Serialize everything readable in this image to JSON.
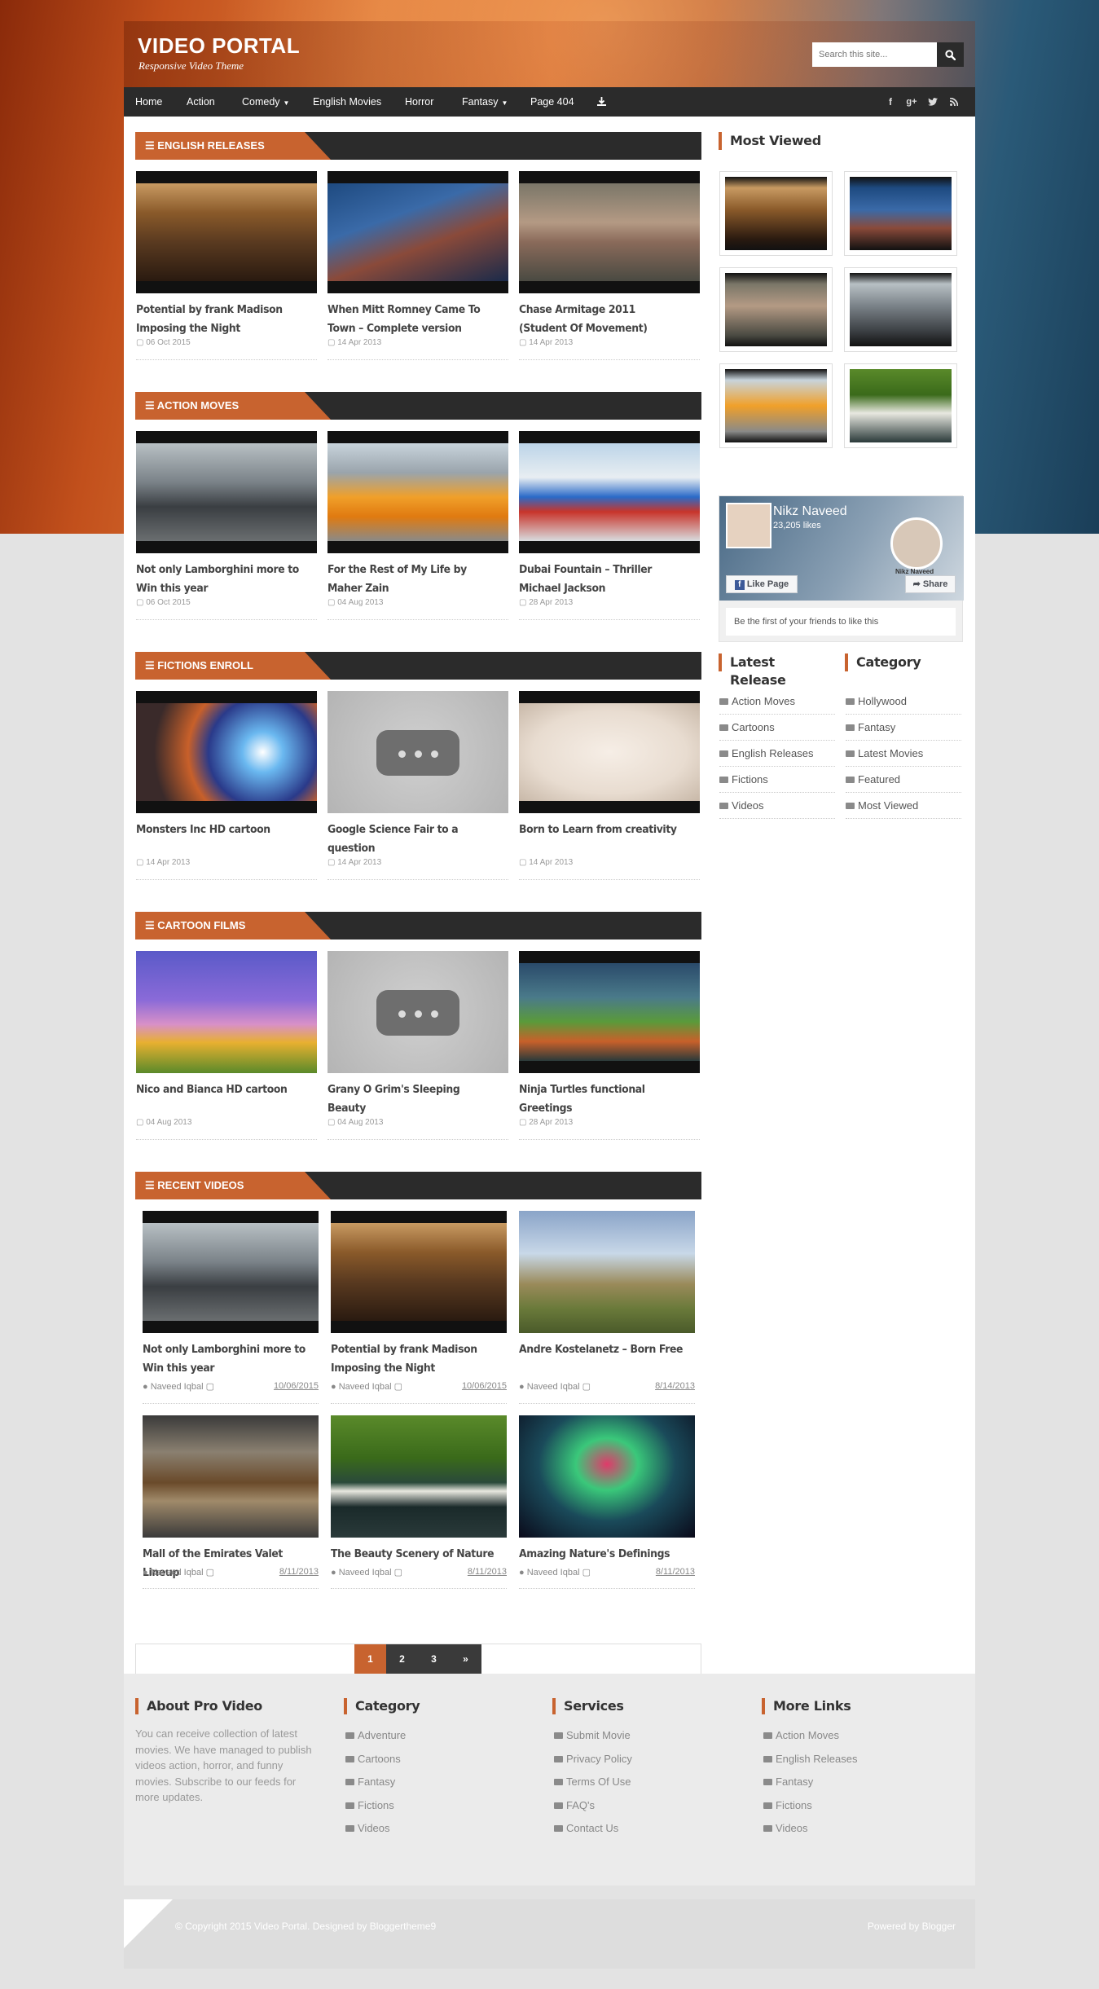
{
  "header": {
    "title": "VIDEO PORTAL",
    "tagline": "Responsive Video Theme",
    "search_placeholder": "Search this site..."
  },
  "nav": {
    "items": [
      "Home",
      "Action",
      "Comedy",
      "English Movies",
      "Horror",
      "Fantasy",
      "Page 404"
    ],
    "dropdown_items": [
      "Comedy",
      "Fantasy"
    ],
    "social": [
      "facebook-icon",
      "google-plus-icon",
      "twitter-icon",
      "rss-icon"
    ]
  },
  "sections": [
    {
      "label": "ENGLISH RELEASES",
      "videos": [
        {
          "title": "Potential by frank Madison Imposing the Night",
          "date": "06 Oct 2015"
        },
        {
          "title": "When Mitt Romney Came To Town – Complete version",
          "date": "14 Apr 2013"
        },
        {
          "title": "Chase Armitage 2011 (Student Of Movement)",
          "date": "14 Apr 2013"
        }
      ]
    },
    {
      "label": "ACTION MOVES",
      "videos": [
        {
          "title": "Not only Lamborghini more to Win this year",
          "date": "06 Oct 2015"
        },
        {
          "title": "For the Rest of My Life by Maher Zain",
          "date": "04 Aug 2013"
        },
        {
          "title": "Dubai Fountain – Thriller Michael Jackson",
          "date": "28 Apr 2013"
        }
      ]
    },
    {
      "label": "FICTIONS ENROLL",
      "videos": [
        {
          "title": "Monsters Inc HD cartoon",
          "date": "14 Apr 2013"
        },
        {
          "title": "Google Science Fair to a question",
          "date": "14 Apr 2013"
        },
        {
          "title": "Born to Learn from creativity",
          "date": "14 Apr 2013"
        }
      ]
    },
    {
      "label": "CARTOON FILMS",
      "videos": [
        {
          "title": "Nico and Bianca HD cartoon",
          "date": "04 Aug 2013"
        },
        {
          "title": "Grany O Grim's Sleeping Beauty",
          "date": "04 Aug 2013"
        },
        {
          "title": "Ninja Turtles functional Greetings",
          "date": "28 Apr 2013"
        }
      ]
    }
  ],
  "recent": {
    "label": "RECENT VIDEOS",
    "videos": [
      {
        "title": "Not only Lamborghini more to Win this year",
        "author": "Naveed Iqbal",
        "date": "10/06/2015"
      },
      {
        "title": "Potential by frank Madison Imposing the Night",
        "author": "Naveed Iqbal",
        "date": "10/06/2015"
      },
      {
        "title": "Andre Kostelanetz – Born Free",
        "author": "Naveed Iqbal",
        "date": "8/14/2013"
      },
      {
        "title": "Mall of the Emirates Valet Lineup",
        "author": "Naveed Iqbal",
        "date": "8/11/2013"
      },
      {
        "title": "The Beauty Scenery of Nature",
        "author": "Naveed Iqbal",
        "date": "8/11/2013"
      },
      {
        "title": "Amazing Nature's Definings",
        "author": "Naveed Iqbal",
        "date": "8/11/2013"
      }
    ]
  },
  "pager": [
    "1",
    "2",
    "3",
    "»"
  ],
  "sidebar": {
    "most_viewed_title": "Most Viewed",
    "facebook": {
      "name": "Nikz Naveed",
      "likes": "23,205 likes",
      "like_button": "Like Page",
      "share_button": "Share",
      "cover_name": "Nikz Naveed",
      "friends_text": "Be the first of your friends to like this"
    },
    "latest_title": "Latest Release",
    "latest_items": [
      "Action Moves",
      "Cartoons",
      "English Releases",
      "Fictions",
      "Videos"
    ],
    "category_title": "Category",
    "category_items": [
      "Hollywood",
      "Fantasy",
      "Latest Movies",
      "Featured",
      "Most Viewed"
    ]
  },
  "footer": {
    "about_title": "About Pro Video",
    "about_text": "You can receive collection of latest movies. We have managed to publish videos action, horror, and funny movies. Subscribe to our feeds for more updates.",
    "category_title": "Category",
    "category_items": [
      "Adventure",
      "Cartoons",
      "Fantasy",
      "Fictions",
      "Videos"
    ],
    "services_title": "Services",
    "services_items": [
      "Submit Movie",
      "Privacy Policy",
      "Terms Of Use",
      "FAQ's",
      "Contact Us"
    ],
    "more_title": "More Links",
    "more_items": [
      "Action Moves",
      "English Releases",
      "Fantasy",
      "Fictions",
      "Videos"
    ],
    "copyright": "© Copyright 2015 Video Portal. Designed by Bloggertheme9",
    "powered": "Powered by Blogger"
  },
  "colors": {
    "accent": "#c8632f",
    "dark_bar": "#2b2b2b",
    "page_bg": "#e3e3e3"
  }
}
